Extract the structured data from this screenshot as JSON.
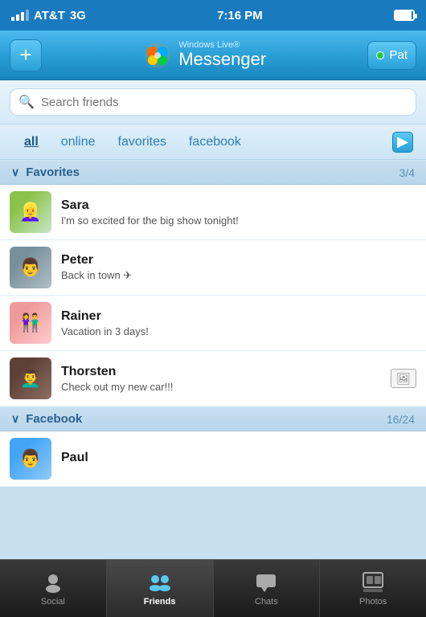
{
  "statusBar": {
    "carrier": "AT&T",
    "network": "3G",
    "time": "7:16 PM"
  },
  "header": {
    "addLabel": "+",
    "logoSubtitle": "Windows Live®",
    "logoTitle": "Messenger",
    "userName": "Pat"
  },
  "search": {
    "placeholder": "Search friends"
  },
  "filterTabs": {
    "tabs": [
      {
        "label": "all",
        "active": true
      },
      {
        "label": "online",
        "active": false
      },
      {
        "label": "favorites",
        "active": false
      },
      {
        "label": "facebook",
        "active": false
      }
    ],
    "moreLabel": "▶"
  },
  "sections": [
    {
      "title": "Favorites",
      "count": "3/4",
      "contacts": [
        {
          "name": "Sara",
          "status": "I'm so excited for the big show tonight!",
          "hasImage": false,
          "avatarType": "sara"
        },
        {
          "name": "Peter",
          "status": "Back in town ✈",
          "hasImage": false,
          "avatarType": "peter"
        },
        {
          "name": "Rainer",
          "status": "Vacation in 3 days!",
          "hasImage": false,
          "avatarType": "rainer"
        },
        {
          "name": "Thorsten",
          "status": "Check out my new car!!!",
          "hasImage": true,
          "avatarType": "thorsten"
        }
      ]
    },
    {
      "title": "Facebook",
      "count": "16/24",
      "contacts": [
        {
          "name": "Paul",
          "status": "",
          "hasImage": false,
          "avatarType": "paul"
        }
      ]
    }
  ],
  "tabBar": {
    "tabs": [
      {
        "label": "Social",
        "icon": "👤",
        "active": false
      },
      {
        "label": "Friends",
        "icon": "👥",
        "active": true
      },
      {
        "label": "Chats",
        "icon": "💬",
        "active": false
      },
      {
        "label": "Photos",
        "icon": "🖼",
        "active": false
      }
    ]
  }
}
